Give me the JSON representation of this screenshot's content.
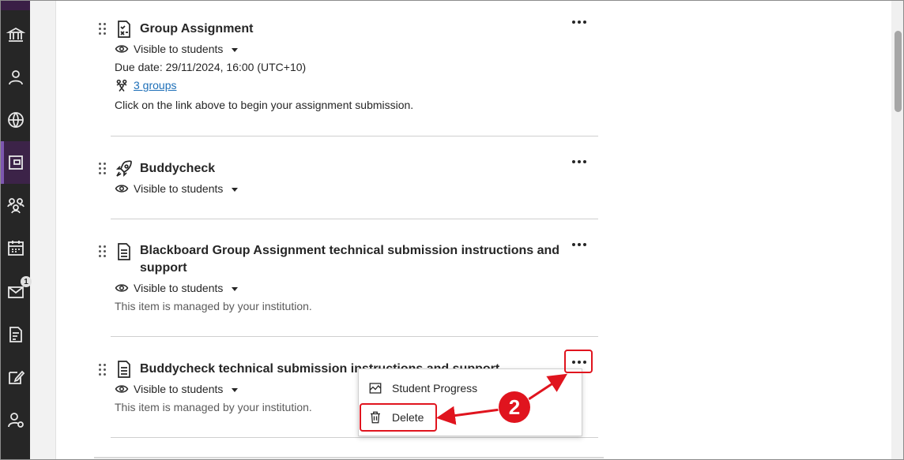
{
  "nav": {
    "icons": [
      "institution-icon",
      "profile-icon",
      "globe-icon",
      "courses-icon",
      "groups-icon",
      "calendar-icon",
      "messages-icon",
      "grades-icon",
      "assignments-icon",
      "tools-icon"
    ],
    "messages_badge": "1"
  },
  "items": [
    {
      "title": "Group Assignment",
      "icon": "assignment-icon",
      "visibility": "Visible to students",
      "due": "Due date: 29/11/2024, 16:00 (UTC+10)",
      "groups_link": "3 groups",
      "note": "Click on the link above to begin your assignment submission."
    },
    {
      "title": "Buddycheck",
      "icon": "rocket-icon",
      "visibility": "Visible to students"
    },
    {
      "title_line1": "Blackboard Group Assignment technical submission instructions and",
      "title_line2": "support",
      "icon": "document-icon",
      "visibility": "Visible to students",
      "note": "This item is managed by your institution."
    },
    {
      "title": "Buddycheck technical submission instructions and support",
      "icon": "document-icon",
      "visibility": "Visible to students",
      "note": "This item is managed by your institution."
    }
  ],
  "menu": {
    "student_progress": "Student Progress",
    "delete": "Delete"
  },
  "callout": "2",
  "colors": {
    "accent": "#e0141e",
    "link": "#1d6fb8",
    "nav": "#262626"
  }
}
